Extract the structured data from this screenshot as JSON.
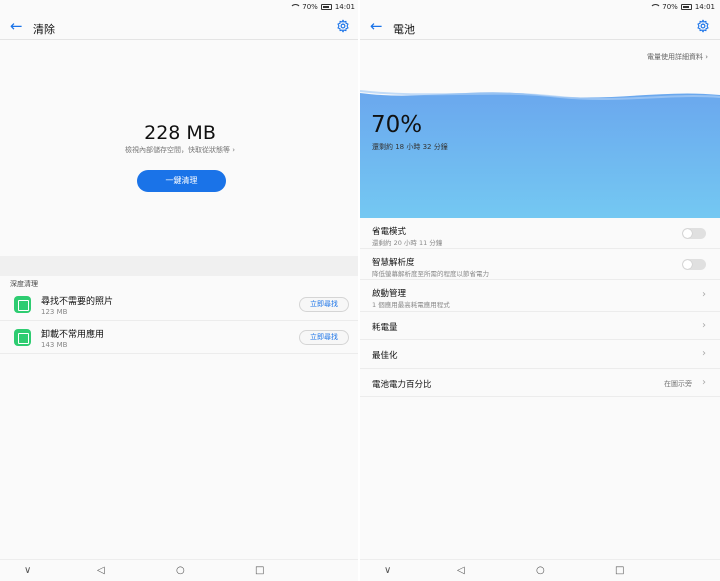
{
  "status": {
    "battery": "70%",
    "time": "14:01"
  },
  "left": {
    "title": "清除",
    "size": "228 MB",
    "caption": "檢視內部儲存空間，快取從狀態等 ›",
    "clean_button": "一鍵清理",
    "section_header": "深度清理",
    "items": [
      {
        "name": "尋找不需要的照片",
        "size": "123 MB",
        "action": "立即尋找"
      },
      {
        "name": "卸載不常用應用",
        "size": "143 MB",
        "action": "立即尋找"
      }
    ]
  },
  "right": {
    "title": "電池",
    "detail_link": "電量使用詳細資料",
    "percent": "70%",
    "remaining": "還剩約 18 小時 32 分鐘",
    "settings": {
      "power_saving": {
        "title": "省電模式",
        "sub": "還剩約 20 小時 11 分鐘",
        "enabled": false
      },
      "smart_resolution": {
        "title": "智慧解析度",
        "sub": "降低螢幕解析度至所需的程度以節省電力",
        "enabled": false
      },
      "startup": {
        "title": "啟動管理",
        "sub": "1 個應用最高耗電應用程式"
      },
      "consumption": {
        "title": "耗電量"
      },
      "optimize": {
        "title": "最佳化"
      },
      "percentage": {
        "title": "電池電力百分比",
        "value": "在圖示旁"
      }
    }
  },
  "colors": {
    "accent": "#1a73e8",
    "wave_top": "#6aa6ee",
    "wave_bottom": "#74c8f2",
    "icon_green": "#2ecc71"
  },
  "icons": [
    "back-arrow-icon",
    "gear-icon",
    "photo-icon",
    "apps-icon",
    "chevron-right-icon",
    "nav-down-icon",
    "nav-back-icon",
    "nav-home-icon",
    "nav-recents-icon",
    "wifi-icon",
    "battery-icon"
  ]
}
